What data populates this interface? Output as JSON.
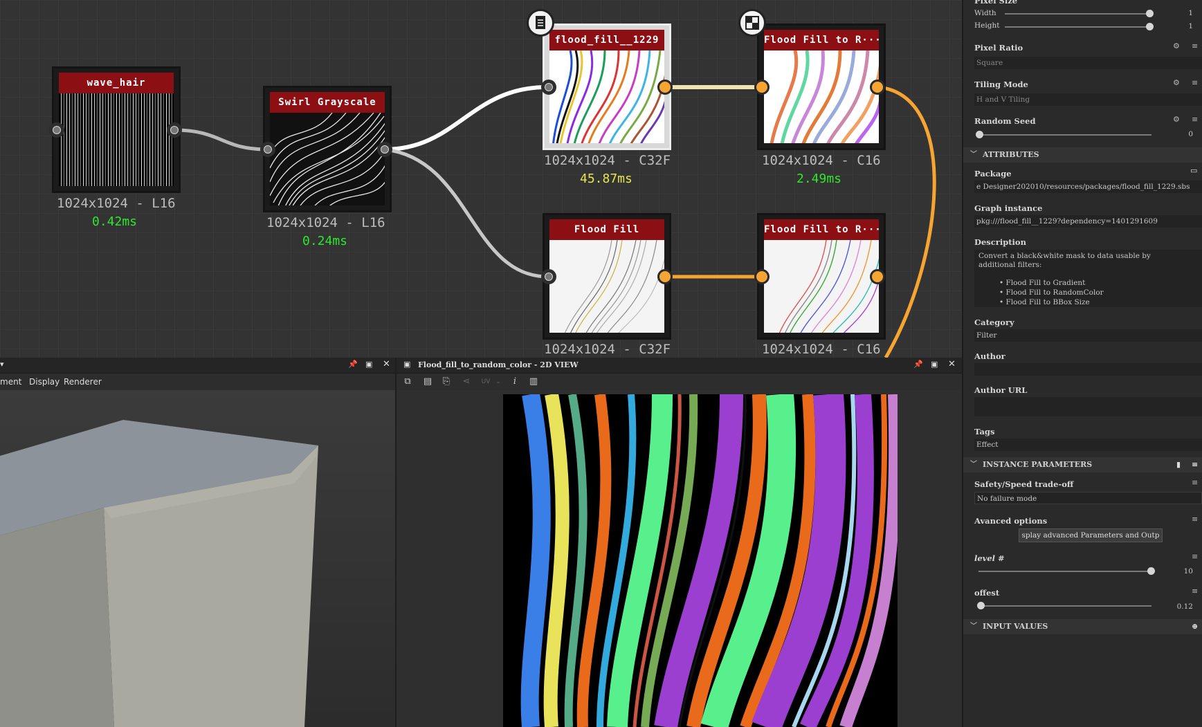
{
  "graph": {
    "nodes": [
      {
        "title": "wave_hair",
        "resolution": "1024x1024 - L16",
        "time": "0.42ms"
      },
      {
        "title": "Swirl Grayscale",
        "resolution": "1024x1024 - L16",
        "time": "0.24ms"
      },
      {
        "title": "flood_fill__1229",
        "resolution": "1024x1024 - C32F",
        "time": "45.87ms"
      },
      {
        "title": "Flood Fill to R···",
        "resolution": "1024x1024 - C16",
        "time": "2.49ms"
      },
      {
        "title": "Flood Fill",
        "resolution": "1024x1024 - C32F",
        "time": ""
      },
      {
        "title": "Flood Fill to R···",
        "resolution": "1024x1024 - C16",
        "time": ""
      }
    ],
    "time_colors": {
      "fast": "#2ee62e",
      "medium": "#e7e64b"
    }
  },
  "view3d": {
    "menu": [
      "ment",
      "Display",
      "Renderer"
    ]
  },
  "view2d": {
    "title": "Flood_fill_to_random_color - 2D VIEW",
    "uv_label": "UV"
  },
  "props": {
    "pixel_size": {
      "label": "Pixel Size",
      "width_label": "Width",
      "width_value": "1",
      "height_label": "Height",
      "height_value": "1"
    },
    "pixel_ratio": {
      "label": "Pixel Ratio",
      "value": "Square"
    },
    "tiling_mode": {
      "label": "Tiling Mode",
      "value": "H and V Tiling"
    },
    "random_seed": {
      "label": "Random Seed",
      "value": "0"
    },
    "attributes": {
      "section": "ATTRIBUTES",
      "package_label": "Package",
      "package_value": "e Designer202010/resources/packages/flood_fill_1229.sbs",
      "graph_instance_label": "Graph instance",
      "graph_instance_value": "pkg:///flood_fill__1229?dependency=1401291609",
      "description_label": "Description",
      "description_text": "Convert a black&white mask to data usable by additional filters:",
      "description_items": [
        "Flood Fill to Gradient",
        "Flood Fill to RandomColor",
        "Flood Fill to BBox Size"
      ],
      "category_label": "Category",
      "category_value": "Filter",
      "author_label": "Author",
      "author_value": "",
      "author_url_label": "Author URL",
      "author_url_value": "",
      "tags_label": "Tags",
      "tags_value": "Effect"
    },
    "instance": {
      "section": "INSTANCE PARAMETERS",
      "safety_label": "Safety/Speed trade-off",
      "safety_value": "No failure mode",
      "advanced_label": "Avanced options",
      "advanced_button": "splay advanced Parameters and Outp",
      "level_label": "level #",
      "level_value": "10",
      "level_fraction": 1.0,
      "offset_label": "offest",
      "offset_value": "0.12",
      "offset_fraction": 0.0
    },
    "input_values": {
      "section": "INPUT VALUES"
    }
  }
}
